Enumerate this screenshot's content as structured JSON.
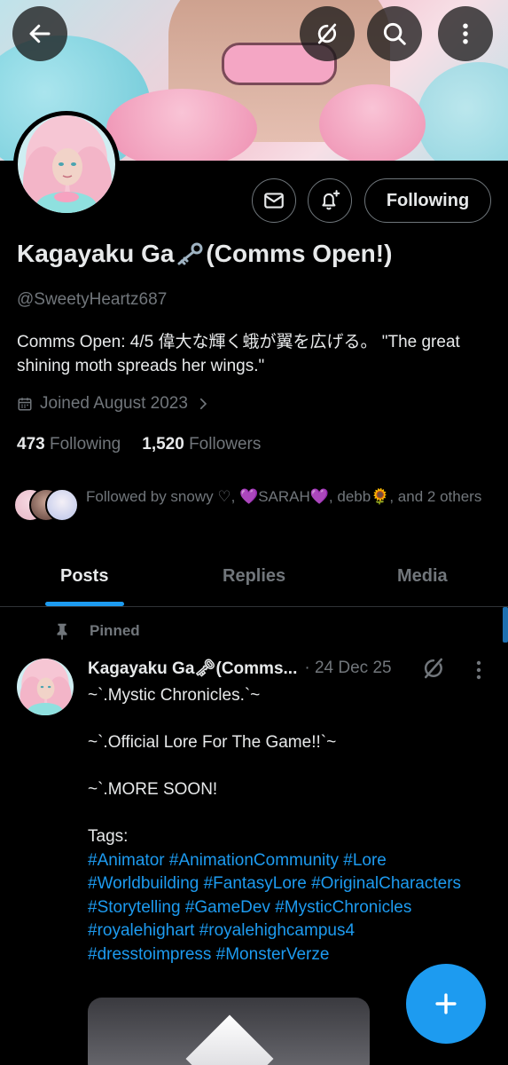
{
  "header": {
    "back_icon": "arrow-left-icon",
    "grok_icon": "grok-icon",
    "search_icon": "search-icon",
    "more_icon": "more-vertical-icon"
  },
  "profile": {
    "name_prefix": "Kagayaku Ga",
    "name_emoji": "key-icon",
    "name_suffix": "(Comms Open!)",
    "handle": "@SweetyHeartz687",
    "bio": "Comms Open: 4/5 偉大な輝く蛾が翼を広げる。 \"The great shining moth spreads her wings.\"",
    "joined": "Joined August 2023",
    "following_count": "473",
    "following_label": "Following",
    "followers_count": "1,520",
    "followers_label": "Followers",
    "followed_by": "Followed by snowy ♡, 💜SARAH💜, debb🌻, and 2 others"
  },
  "actions": {
    "message_icon": "mail-icon",
    "notify_icon": "bell-plus-icon",
    "follow_label": "Following"
  },
  "tabs": [
    {
      "label": "Posts",
      "active": true
    },
    {
      "label": "Replies",
      "active": false
    },
    {
      "label": "Media",
      "active": false
    }
  ],
  "post": {
    "pinned_label": "Pinned",
    "author": "Kagayaku Ga🗝(Comms...",
    "date": "· 24 Dec 25",
    "lines": [
      "~`.Mystic Chronicles.`~",
      "",
      "~`.Official Lore For The Game!!`~",
      "",
      "~`.MORE SOON!",
      "",
      "Tags:"
    ],
    "tags": "#Animator #AnimationCommunity #Lore #Worldbuilding #FantasyLore #OriginalCharacters #Storytelling #GameDev #MysticChronicles #royalehighart #royalehighcampus4 #dresstoimpress #MonsterVerze"
  },
  "colors": {
    "accent": "#1d9bf0",
    "muted": "#71767b",
    "text": "#e7e9ea",
    "background": "#000000"
  }
}
